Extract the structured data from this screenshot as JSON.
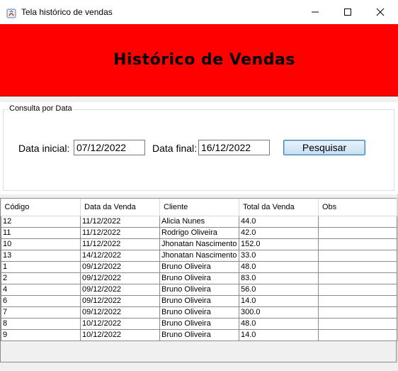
{
  "window": {
    "title": "Tela histórico de vendas",
    "controls": {
      "minimize": "minimize",
      "maximize": "maximize",
      "close": "close"
    }
  },
  "header": {
    "title": "Histórico de Vendas",
    "background_color": "#ff0000"
  },
  "consulta": {
    "legend": "Consulta por Data",
    "data_inicial_label": "Data inicial:",
    "data_inicial_value": "07/12/2022",
    "data_final_label": "Data final:",
    "data_final_value": "16/12/2022",
    "pesquisar_label": "Pesquisar"
  },
  "table": {
    "columns": [
      "Código",
      "Data da Venda",
      "Cliente",
      "Total da Venda",
      "Obs"
    ],
    "rows": [
      [
        "12",
        "11/12/2022",
        "Alicia Nunes",
        "44.0",
        ""
      ],
      [
        "11",
        "11/12/2022",
        "Rodrigo Oliveira",
        "42.0",
        ""
      ],
      [
        "10",
        "11/12/2022",
        "Jhonatan Nascimento",
        "152.0",
        ""
      ],
      [
        "13",
        "14/12/2022",
        "Jhonatan Nascimento",
        "33.0",
        ""
      ],
      [
        "1",
        "09/12/2022",
        "Bruno Oliveira",
        "48.0",
        ""
      ],
      [
        "2",
        "09/12/2022",
        "Bruno Oliveira",
        "83.0",
        ""
      ],
      [
        "4",
        "09/12/2022",
        "Bruno Oliveira",
        "56.0",
        ""
      ],
      [
        "6",
        "09/12/2022",
        "Bruno Oliveira",
        "14.0",
        ""
      ],
      [
        "7",
        "09/12/2022",
        "Bruno Oliveira",
        "300.0",
        ""
      ],
      [
        "8",
        "10/12/2022",
        "Bruno Oliveira",
        "48.0",
        ""
      ],
      [
        "9",
        "10/12/2022",
        "Bruno Oliveira",
        "14.0",
        ""
      ]
    ]
  }
}
